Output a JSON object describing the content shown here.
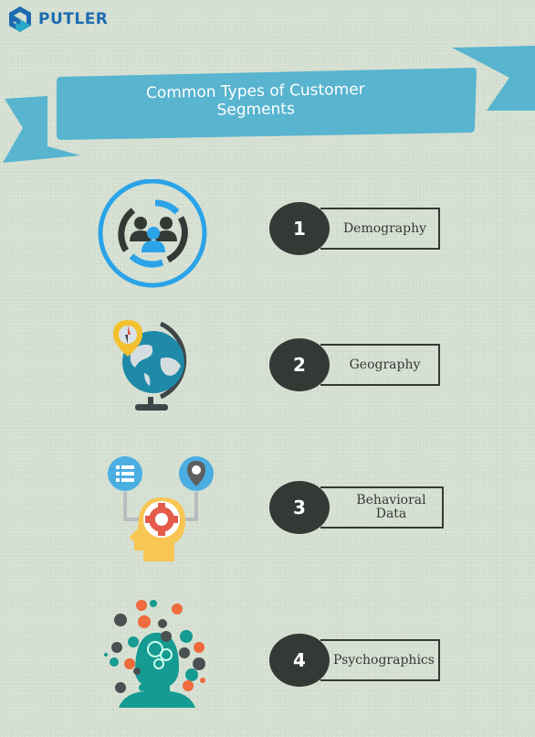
{
  "brand": {
    "name": "PUTLER",
    "color": "#1e6bb0"
  },
  "banner": {
    "title": "Common Types of Customer Segments",
    "color": "#58b4cf"
  },
  "segments": [
    {
      "number": "1",
      "label": "Demography",
      "icon": "demography-users-icon"
    },
    {
      "number": "2",
      "label": "Geography",
      "icon": "globe-compass-icon"
    },
    {
      "number": "3",
      "label": "Behavioral Data",
      "icon": "head-gear-icon"
    },
    {
      "number": "4",
      "label": "Psychographics",
      "icon": "head-social-icons-icon"
    }
  ],
  "colors": {
    "dark": "#333a35",
    "accent_blue": "#2ba3e8",
    "background": "#d4dfd1"
  }
}
